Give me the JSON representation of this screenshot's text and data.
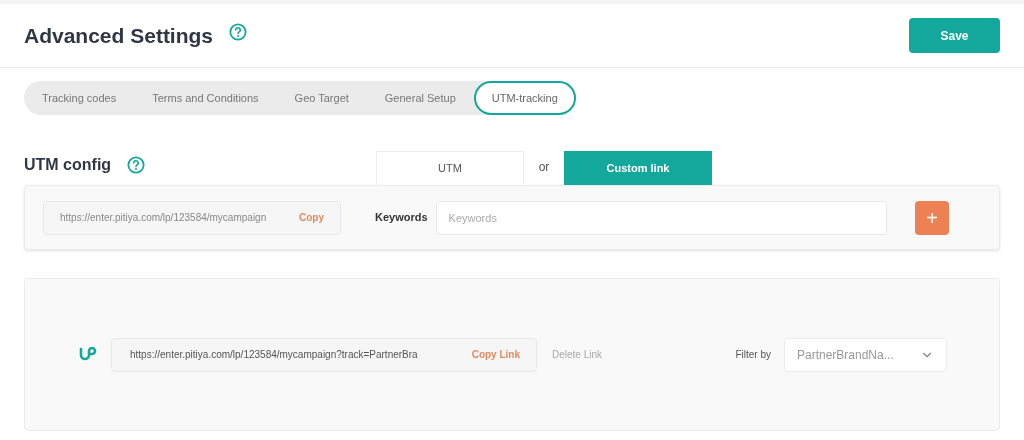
{
  "header": {
    "title": "Advanced Settings",
    "save": "Save"
  },
  "tabs": [
    {
      "label": "Tracking codes",
      "selected": false
    },
    {
      "label": "Terms and Conditions",
      "selected": false
    },
    {
      "label": "Geo Target",
      "selected": false
    },
    {
      "label": "General Setup",
      "selected": false
    },
    {
      "label": "UTM-tracking",
      "selected": true
    }
  ],
  "utm_config": {
    "title": "UTM config",
    "modes": [
      {
        "label": "UTM",
        "selected": false
      },
      {
        "label": "Custom link",
        "selected": true
      }
    ],
    "or": "or",
    "url": "https://enter.pitiya.com/lp/123584/mycampaign",
    "copy": "Copy",
    "keywords_label": "Keywords",
    "keywords_placeholder": "Keywords",
    "add": "+"
  },
  "links": {
    "url": "https://enter.pitiya.com/lp/123584/mycampaign?track=PartnerBra",
    "copy": "Copy Link",
    "delete": {
      "label": "Delete Link",
      "disabled": true
    },
    "filter_label": "Filter by",
    "filter_value": "PartnerBrandNa..."
  }
}
